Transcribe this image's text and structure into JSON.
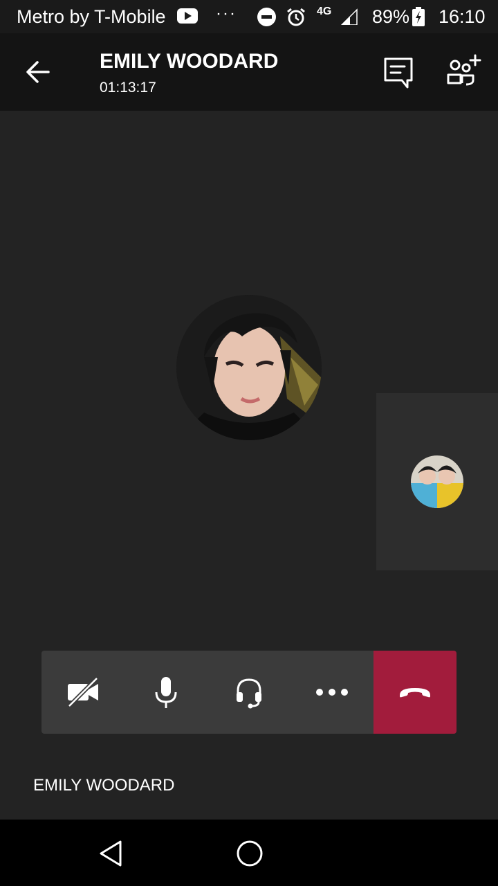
{
  "status_bar": {
    "carrier": "Metro by T-Mobile",
    "overflow": "···",
    "network": "4G",
    "battery": "89%",
    "time": "16:10",
    "icons": [
      "youtube-icon",
      "do-not-disturb-icon",
      "alarm-icon",
      "signal-icon",
      "battery-charging-icon"
    ]
  },
  "header": {
    "title": "EMILY WOODARD",
    "timer": "01:13:17",
    "icons": [
      "back-arrow-icon",
      "chat-icon",
      "add-people-icon"
    ]
  },
  "controls": {
    "items": [
      {
        "name": "video-off",
        "icon": "video-off-icon"
      },
      {
        "name": "microphone",
        "icon": "microphone-icon"
      },
      {
        "name": "audio-device",
        "icon": "headset-icon"
      },
      {
        "name": "more-options",
        "icon": "more-horizontal-icon"
      },
      {
        "name": "hang-up",
        "icon": "hang-up-icon"
      }
    ],
    "hangup_color": "#a21c3c"
  },
  "participant": {
    "name": "EMILY WOODARD"
  },
  "nav": {
    "icons": [
      "nav-back-icon",
      "nav-home-icon"
    ]
  },
  "colors": {
    "background": "#232323",
    "header": "#141414",
    "control_bar": "#3b3b3b",
    "hangup": "#a21c3c"
  }
}
